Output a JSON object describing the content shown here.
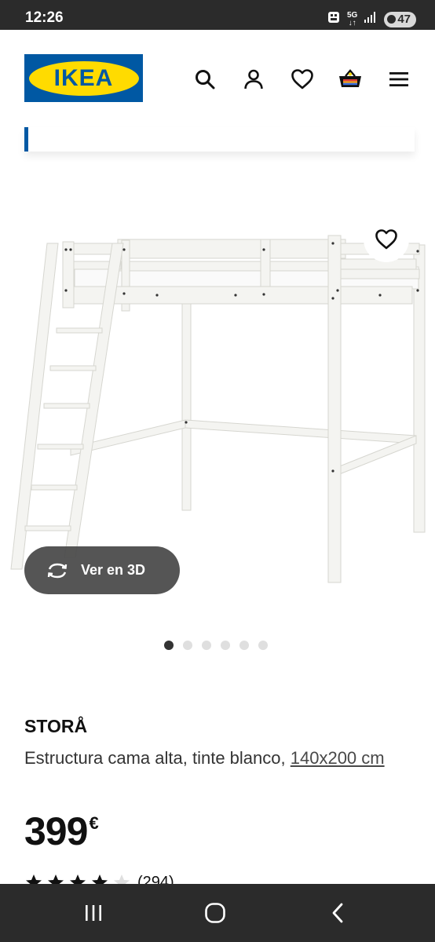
{
  "status_bar": {
    "time": "12:26",
    "network": "5G",
    "battery": "47",
    "icons": [
      "notification-icon",
      "network-5g-icon",
      "signal-icon",
      "battery-icon"
    ]
  },
  "header": {
    "logo_text": "IKEA",
    "icons": [
      "search-icon",
      "account-icon",
      "heart-icon",
      "basket-icon",
      "menu-icon"
    ],
    "brand_blue": "#0058a3",
    "brand_yellow": "#ffdb00"
  },
  "gallery": {
    "view_3d_label": "Ver en 3D",
    "slide_count": 6,
    "active_slide": 1
  },
  "product": {
    "name": "STORÅ",
    "description": "Estructura cama alta, tinte blanco,",
    "size": "140x200 cm",
    "price": "399",
    "currency": "€",
    "rating": 4,
    "rating_max": 5,
    "reviews": "(294)"
  },
  "nav_bar": {
    "icons": [
      "recent-apps-icon",
      "home-icon",
      "back-icon"
    ]
  }
}
